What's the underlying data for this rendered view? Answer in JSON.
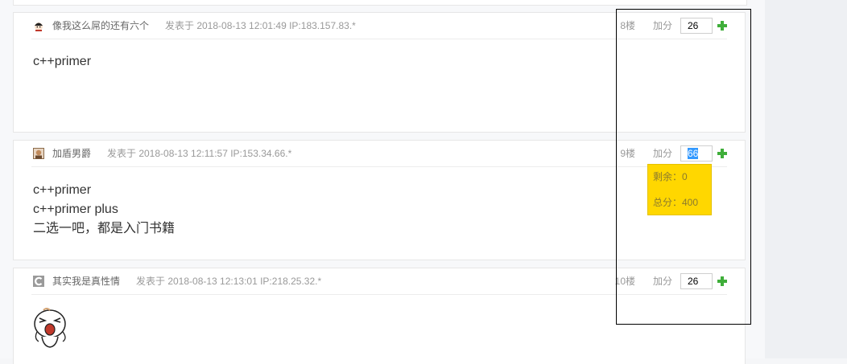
{
  "posts": [
    {
      "author": "像我这么屌的还有六个",
      "meta": "发表于 2018-08-13 12:01:49 IP:183.157.83.*",
      "floor": "8楼",
      "add_label": "加分",
      "score": "26",
      "content_lines": [
        "c++primer"
      ]
    },
    {
      "author": "加盾男爵",
      "meta": "发表于 2018-08-13 12:11:57 IP:153.34.66.*",
      "floor": "9楼",
      "add_label": "加分",
      "score": "66",
      "content_lines": [
        "c++primer",
        "c++primer plus",
        "二选一吧，都是入门书籍"
      ]
    },
    {
      "author": "其实我是真性情",
      "meta": "发表于 2018-08-13 12:13:01 IP:218.25.32.*",
      "floor": "10楼",
      "add_label": "加分",
      "score": "26",
      "content_lines": []
    }
  ],
  "tooltip": {
    "remaining": "剩余：0",
    "total": "总分：400"
  },
  "colors": {
    "accent_green": "#3fae3a",
    "tooltip_bg": "#ffd700",
    "selection": "#3399ff"
  }
}
